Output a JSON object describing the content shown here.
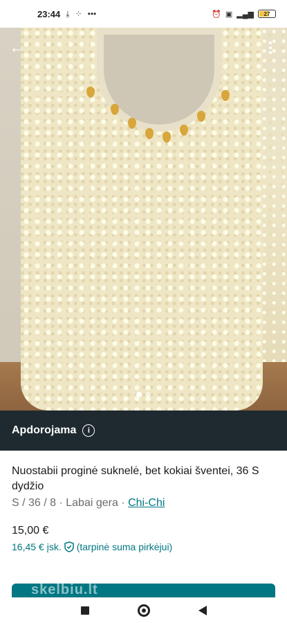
{
  "status_bar": {
    "time": "23:44",
    "left_icons": [
      "download-icon",
      "grid-icon",
      "more-dots-icon"
    ],
    "battery_level": "27",
    "right_icons": [
      "alarm-icon",
      "vowifi-icon",
      "signal-icon",
      "battery-icon"
    ]
  },
  "gallery": {
    "image_count": 2,
    "active_index": 0,
    "back_icon": "arrow-left-icon",
    "menu_icon": "more-vertical-icon"
  },
  "processing_banner": {
    "label": "Apdorojama",
    "icon": "info-icon"
  },
  "listing": {
    "title": "Nuostabii proginė suknelė, bet kokiai  šventei, 36 S dydžio",
    "meta_prefix": "S / 36 / 8 · Labai gera · ",
    "brand": "Chi-Chi",
    "price": "15,00 €",
    "buyer_price": "16,45 €",
    "buyer_price_suffix": "įsk.",
    "buyer_note": "(tarpinė suma pirkėjui)"
  },
  "watermark": "skelbiu.lt",
  "colors": {
    "accent": "#007782",
    "banner": "#1f2a30",
    "muted_text": "#6b6b6b"
  }
}
